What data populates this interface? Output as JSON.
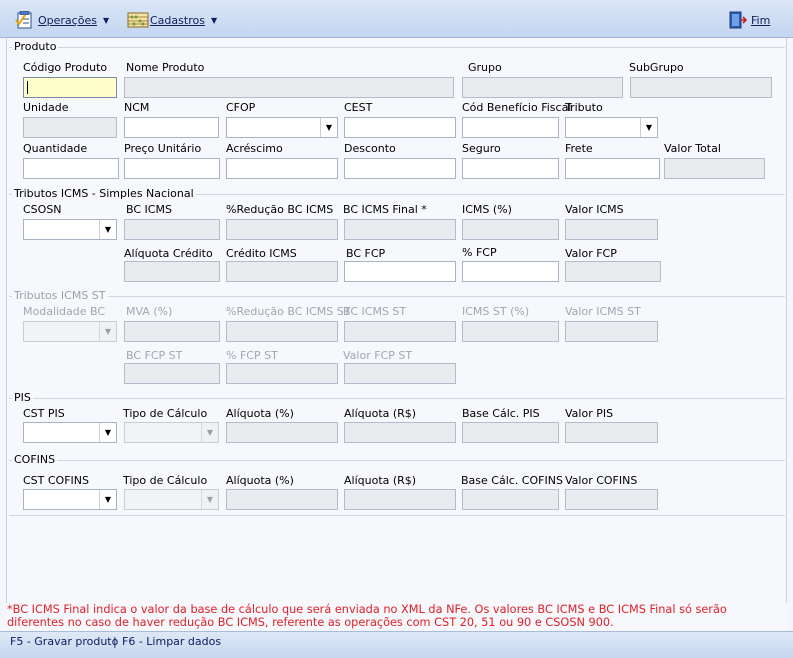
{
  "menu": {
    "operacoes": "Operações",
    "cadastros": "Cadastros",
    "fim": "Fim"
  },
  "produto": {
    "title": "Produto",
    "codigo_label": "Código Produto",
    "nome_label": "Nome Produto",
    "grupo_label": "Grupo",
    "subgrupo_label": "SubGrupo",
    "unidade_label": "Unidade",
    "ncm_label": "NCM",
    "cfop_label": "CFOP",
    "cest_label": "CEST",
    "beneficio_label": "Cód Benefício Fiscal",
    "tributo_label": "Tributo",
    "quantidade_label": "Quantidade",
    "preco_label": "Preço Unitário",
    "acrescimo_label": "Acréscimo",
    "desconto_label": "Desconto",
    "seguro_label": "Seguro",
    "frete_label": "Frete",
    "valor_total_label": "Valor Total"
  },
  "icms_sn": {
    "title": "Tributos ICMS - Simples Nacional",
    "csosn_label": "CSOSN",
    "bc_icms_label": "BC ICMS",
    "reducao_label": "%Redução BC ICMS",
    "bc_final_label": "BC ICMS Final *",
    "icms_pct_label": "ICMS (%)",
    "valor_icms_label": "Valor ICMS",
    "aliq_credito_label": "Alíquota Crédito",
    "credito_label": "Crédito ICMS",
    "bc_fcp_label": "BC FCP",
    "pct_fcp_label": "% FCP",
    "valor_fcp_label": "Valor FCP"
  },
  "icms_st": {
    "title": "Tributos ICMS ST",
    "modalidade_label": "Modalidade BC",
    "mva_label": "MVA (%)",
    "reducao_st_label": "%Redução BC ICMS ST",
    "bc_st_label": "BC ICMS ST",
    "icms_st_pct_label": "ICMS ST (%)",
    "valor_st_label": "Valor ICMS ST",
    "bc_fcp_st_label": "BC FCP ST",
    "pct_fcp_st_label": "% FCP ST",
    "valor_fcp_st_label": "Valor FCP ST"
  },
  "pis": {
    "title": "PIS",
    "cst_label": "CST PIS",
    "tipo_label": "Tipo de Cálculo",
    "aliq_pct_label": "Alíquota (%)",
    "aliq_rs_label": "Alíquota (R$)",
    "base_label": "Base Cálc. PIS",
    "valor_label": "Valor PIS"
  },
  "cofins": {
    "title": "COFINS",
    "cst_label": "CST COFINS",
    "tipo_label": "Tipo de Cálculo",
    "aliq_pct_label": "Alíquota (%)",
    "aliq_rs_label": "Alíquota (R$)",
    "base_label": "Base Cálc. COFINS",
    "valor_label": "Valor COFINS"
  },
  "footnote": "*BC ICMS Final indica o valor da base de cálculo que será enviada no XML da NFe. Os valores BC ICMS e BC ICMS Final só serão diferentes no caso de haver redução BC ICMS, referente as operações com CST 20, 51 ou 90 e CSOSN 900.",
  "status": {
    "f5": "F5 - Gravar produto",
    "sep": "|",
    "f6": "F6 - Limpar dados"
  },
  "icons": {
    "operacoes": "checklist-icon",
    "cadastros": "abacus-icon",
    "fim": "exit-door-icon",
    "dropdown": "chevron-down-icon"
  }
}
